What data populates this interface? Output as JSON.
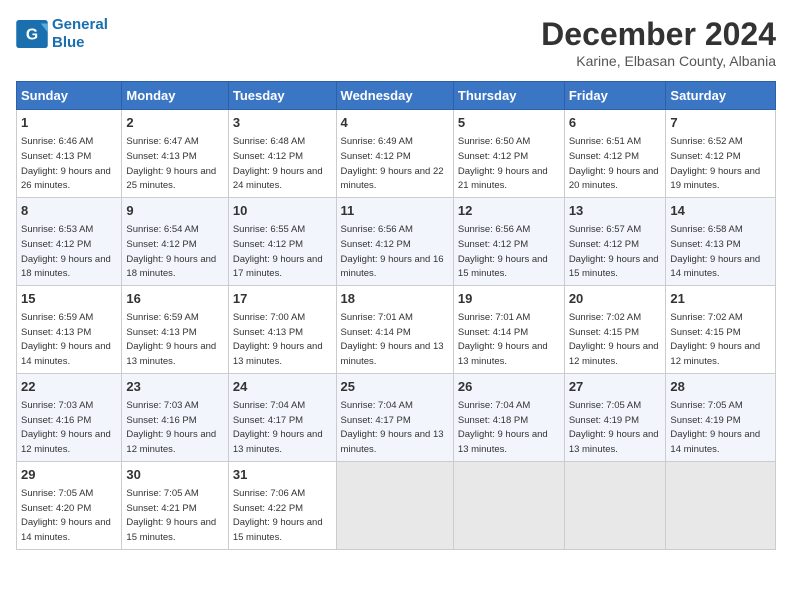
{
  "logo": {
    "line1": "General",
    "line2": "Blue"
  },
  "title": "December 2024",
  "subtitle": "Karine, Elbasan County, Albania",
  "headers": [
    "Sunday",
    "Monday",
    "Tuesday",
    "Wednesday",
    "Thursday",
    "Friday",
    "Saturday"
  ],
  "weeks": [
    [
      {
        "day": "1",
        "sunrise": "6:46 AM",
        "sunset": "4:13 PM",
        "daylight": "9 hours and 26 minutes."
      },
      {
        "day": "2",
        "sunrise": "6:47 AM",
        "sunset": "4:13 PM",
        "daylight": "9 hours and 25 minutes."
      },
      {
        "day": "3",
        "sunrise": "6:48 AM",
        "sunset": "4:12 PM",
        "daylight": "9 hours and 24 minutes."
      },
      {
        "day": "4",
        "sunrise": "6:49 AM",
        "sunset": "4:12 PM",
        "daylight": "9 hours and 22 minutes."
      },
      {
        "day": "5",
        "sunrise": "6:50 AM",
        "sunset": "4:12 PM",
        "daylight": "9 hours and 21 minutes."
      },
      {
        "day": "6",
        "sunrise": "6:51 AM",
        "sunset": "4:12 PM",
        "daylight": "9 hours and 20 minutes."
      },
      {
        "day": "7",
        "sunrise": "6:52 AM",
        "sunset": "4:12 PM",
        "daylight": "9 hours and 19 minutes."
      }
    ],
    [
      {
        "day": "8",
        "sunrise": "6:53 AM",
        "sunset": "4:12 PM",
        "daylight": "9 hours and 18 minutes."
      },
      {
        "day": "9",
        "sunrise": "6:54 AM",
        "sunset": "4:12 PM",
        "daylight": "9 hours and 18 minutes."
      },
      {
        "day": "10",
        "sunrise": "6:55 AM",
        "sunset": "4:12 PM",
        "daylight": "9 hours and 17 minutes."
      },
      {
        "day": "11",
        "sunrise": "6:56 AM",
        "sunset": "4:12 PM",
        "daylight": "9 hours and 16 minutes."
      },
      {
        "day": "12",
        "sunrise": "6:56 AM",
        "sunset": "4:12 PM",
        "daylight": "9 hours and 15 minutes."
      },
      {
        "day": "13",
        "sunrise": "6:57 AM",
        "sunset": "4:12 PM",
        "daylight": "9 hours and 15 minutes."
      },
      {
        "day": "14",
        "sunrise": "6:58 AM",
        "sunset": "4:13 PM",
        "daylight": "9 hours and 14 minutes."
      }
    ],
    [
      {
        "day": "15",
        "sunrise": "6:59 AM",
        "sunset": "4:13 PM",
        "daylight": "9 hours and 14 minutes."
      },
      {
        "day": "16",
        "sunrise": "6:59 AM",
        "sunset": "4:13 PM",
        "daylight": "9 hours and 13 minutes."
      },
      {
        "day": "17",
        "sunrise": "7:00 AM",
        "sunset": "4:13 PM",
        "daylight": "9 hours and 13 minutes."
      },
      {
        "day": "18",
        "sunrise": "7:01 AM",
        "sunset": "4:14 PM",
        "daylight": "9 hours and 13 minutes."
      },
      {
        "day": "19",
        "sunrise": "7:01 AM",
        "sunset": "4:14 PM",
        "daylight": "9 hours and 13 minutes."
      },
      {
        "day": "20",
        "sunrise": "7:02 AM",
        "sunset": "4:15 PM",
        "daylight": "9 hours and 12 minutes."
      },
      {
        "day": "21",
        "sunrise": "7:02 AM",
        "sunset": "4:15 PM",
        "daylight": "9 hours and 12 minutes."
      }
    ],
    [
      {
        "day": "22",
        "sunrise": "7:03 AM",
        "sunset": "4:16 PM",
        "daylight": "9 hours and 12 minutes."
      },
      {
        "day": "23",
        "sunrise": "7:03 AM",
        "sunset": "4:16 PM",
        "daylight": "9 hours and 12 minutes."
      },
      {
        "day": "24",
        "sunrise": "7:04 AM",
        "sunset": "4:17 PM",
        "daylight": "9 hours and 13 minutes."
      },
      {
        "day": "25",
        "sunrise": "7:04 AM",
        "sunset": "4:17 PM",
        "daylight": "9 hours and 13 minutes."
      },
      {
        "day": "26",
        "sunrise": "7:04 AM",
        "sunset": "4:18 PM",
        "daylight": "9 hours and 13 minutes."
      },
      {
        "day": "27",
        "sunrise": "7:05 AM",
        "sunset": "4:19 PM",
        "daylight": "9 hours and 13 minutes."
      },
      {
        "day": "28",
        "sunrise": "7:05 AM",
        "sunset": "4:19 PM",
        "daylight": "9 hours and 14 minutes."
      }
    ],
    [
      {
        "day": "29",
        "sunrise": "7:05 AM",
        "sunset": "4:20 PM",
        "daylight": "9 hours and 14 minutes."
      },
      {
        "day": "30",
        "sunrise": "7:05 AM",
        "sunset": "4:21 PM",
        "daylight": "9 hours and 15 minutes."
      },
      {
        "day": "31",
        "sunrise": "7:06 AM",
        "sunset": "4:22 PM",
        "daylight": "9 hours and 15 minutes."
      },
      null,
      null,
      null,
      null
    ]
  ]
}
